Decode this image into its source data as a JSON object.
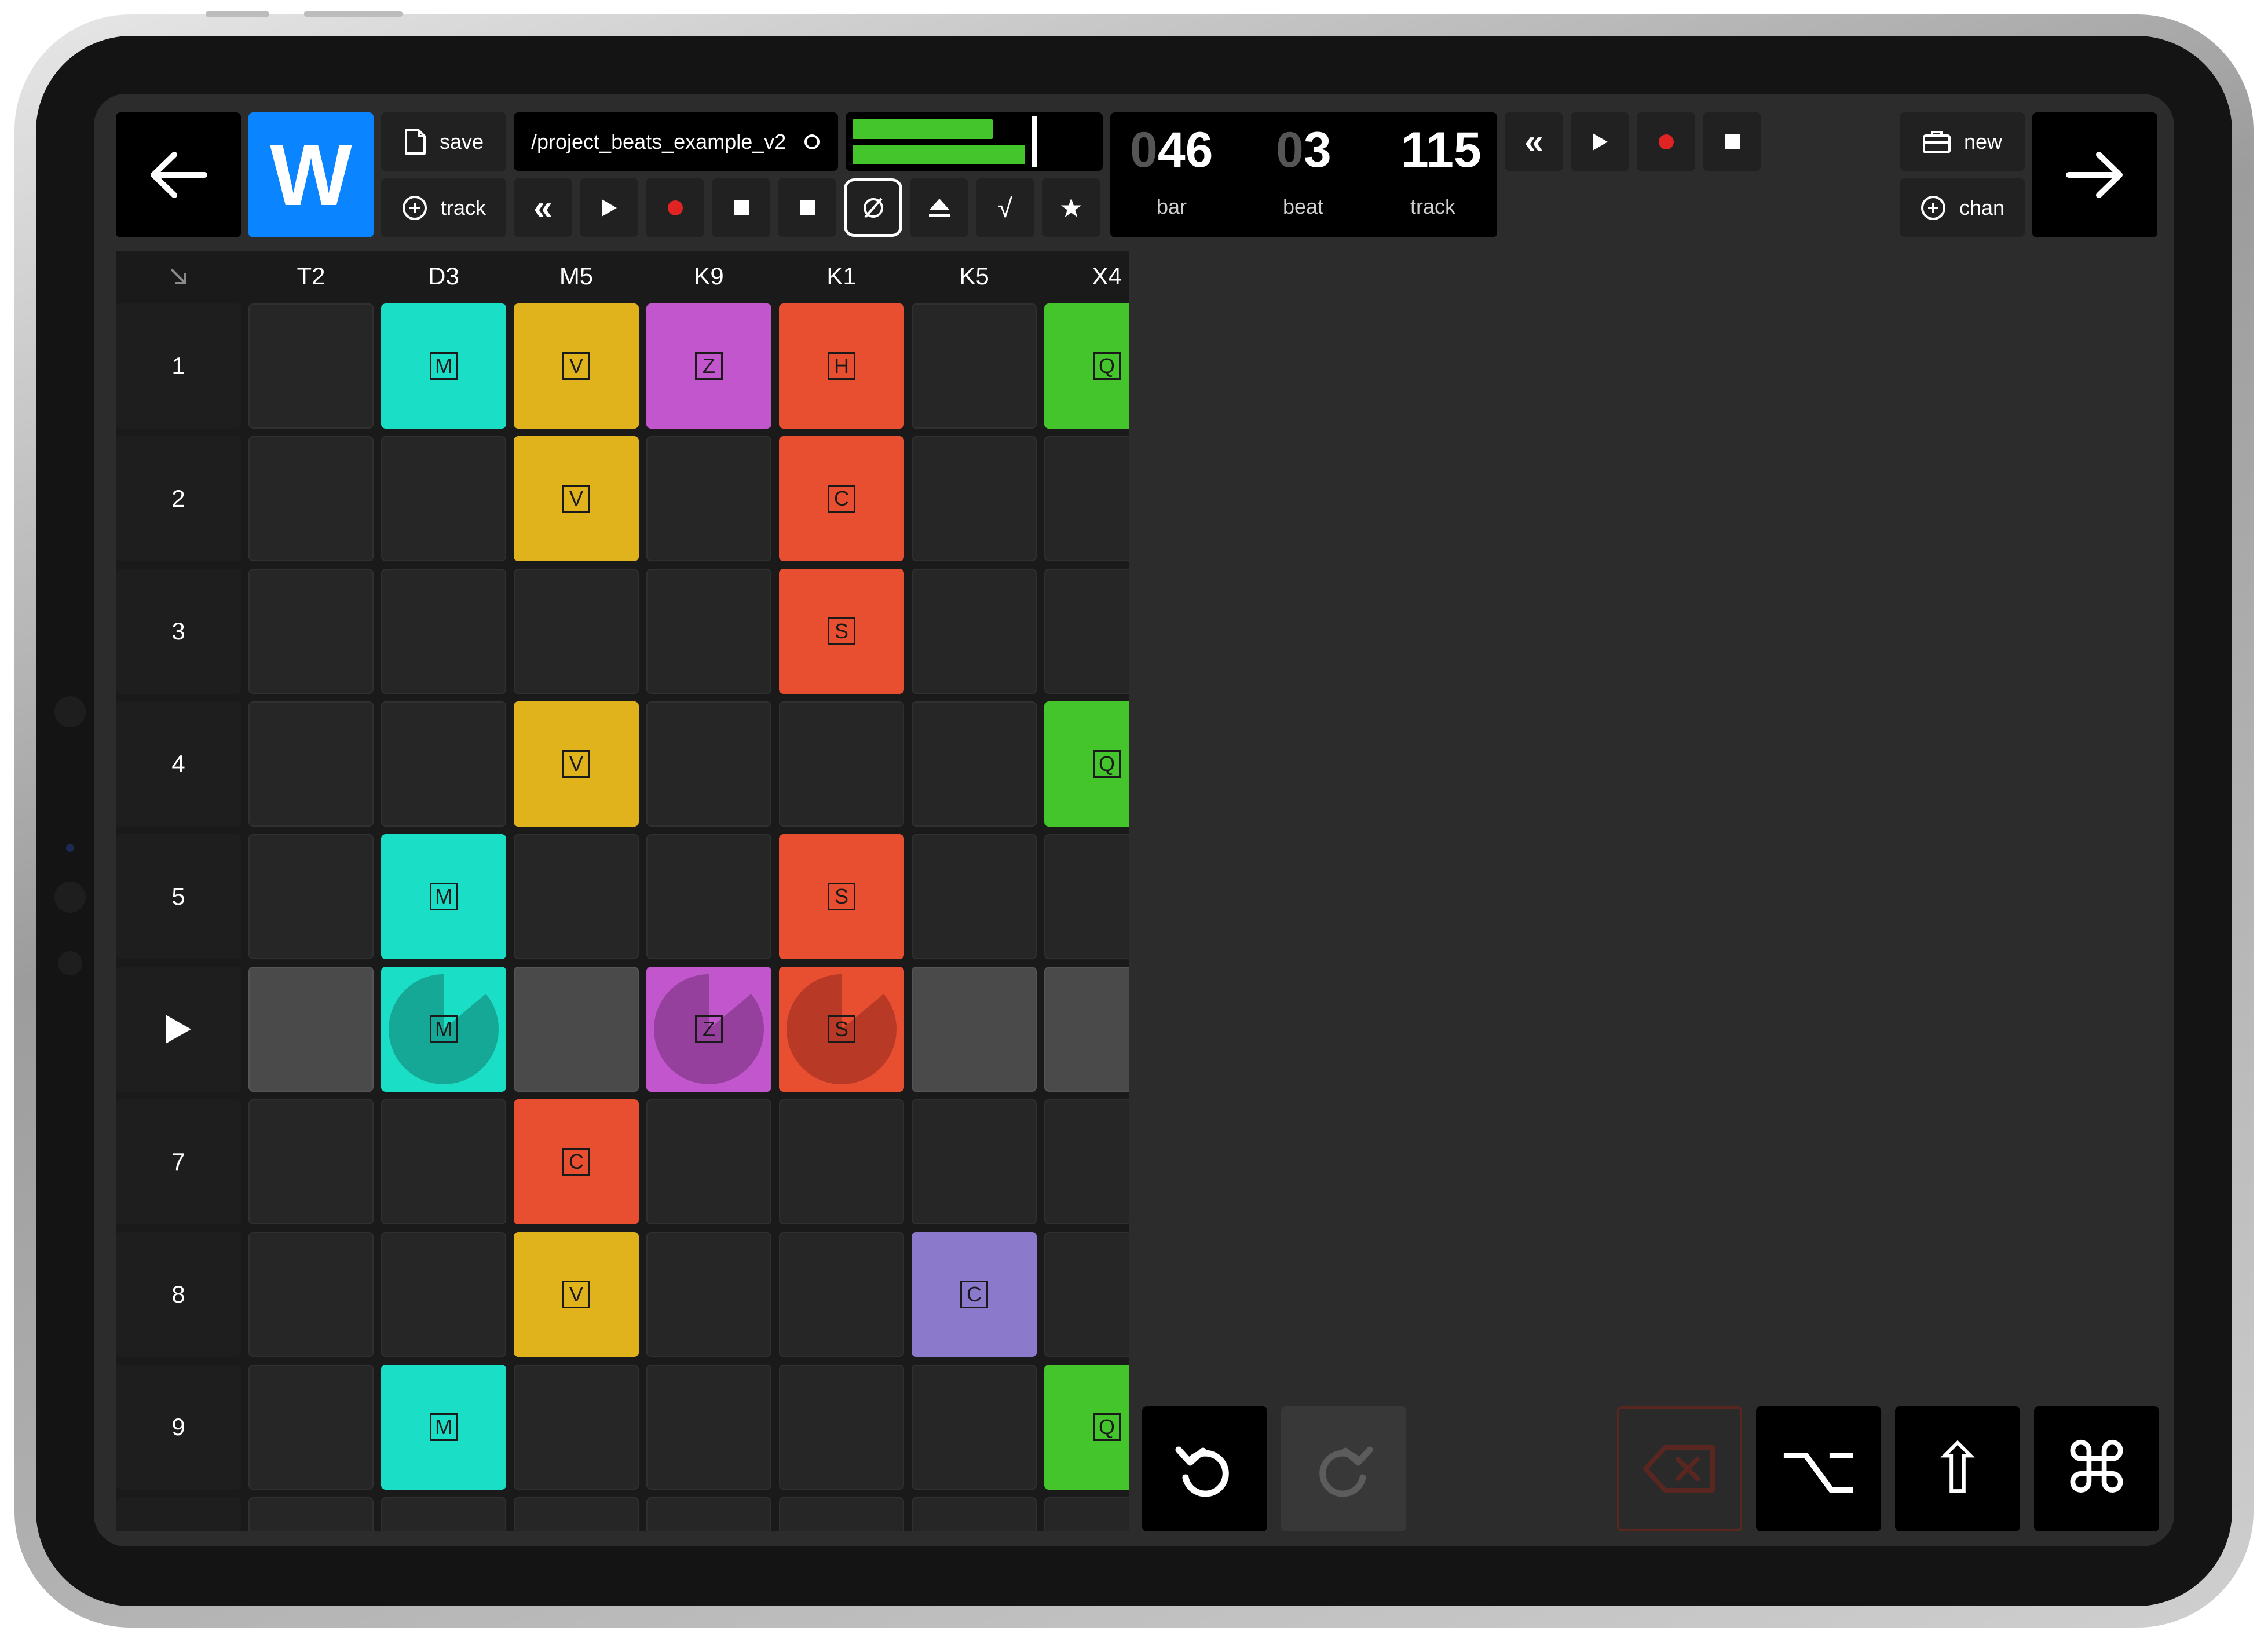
{
  "toolbar": {
    "save_label": "save",
    "track_label": "track",
    "project_path": "/project_beats_example_v2",
    "logo_letter": "W",
    "new_label": "new",
    "chan_label": "chan"
  },
  "counters": {
    "bar_dim": "0",
    "bar_value": "46",
    "bar_label": "bar",
    "beat_dim": "0",
    "beat_value": "3",
    "beat_label": "beat",
    "track_value": "115",
    "track_label": "track"
  },
  "level_meter": {
    "left": 0.78,
    "right": 0.96
  },
  "colors": {
    "accent_blue": "#0a84ff",
    "teal": "#1adec5",
    "yellow": "#e0b21c",
    "purple": "#c256cc",
    "orange": "#e84f31",
    "green": "#45c52c",
    "lavender": "#8b79cc",
    "record_red": "#e02424"
  },
  "grid": {
    "columns": [
      "T2",
      "D3",
      "M5",
      "K9",
      "K1",
      "K5",
      "X4"
    ],
    "rows": [
      "1",
      "2",
      "3",
      "4",
      "5",
      "▶",
      "7",
      "8",
      "9"
    ],
    "clips": [
      [
        "",
        "M",
        "V",
        "Z",
        "H",
        "",
        "Q"
      ],
      [
        "",
        "",
        "V",
        "",
        "C",
        "",
        ""
      ],
      [
        "",
        "",
        "",
        "",
        "S",
        "",
        ""
      ],
      [
        "",
        "",
        "V",
        "",
        "",
        "",
        "Q"
      ],
      [
        "",
        "M",
        "",
        "",
        "S",
        "",
        ""
      ],
      [
        "",
        "M",
        "",
        "Z",
        "S",
        "",
        ""
      ],
      [
        "",
        "",
        "C",
        "",
        "",
        "",
        ""
      ],
      [
        "",
        "",
        "V",
        "",
        "",
        "C",
        ""
      ],
      [
        "",
        "M",
        "",
        "",
        "",
        "",
        "Q"
      ]
    ]
  },
  "keys": {
    "undo": "undo-icon",
    "redo": "redo-icon",
    "delete": "backspace-icon",
    "option": "⌥",
    "shift": "⇧",
    "command": "⌘"
  }
}
